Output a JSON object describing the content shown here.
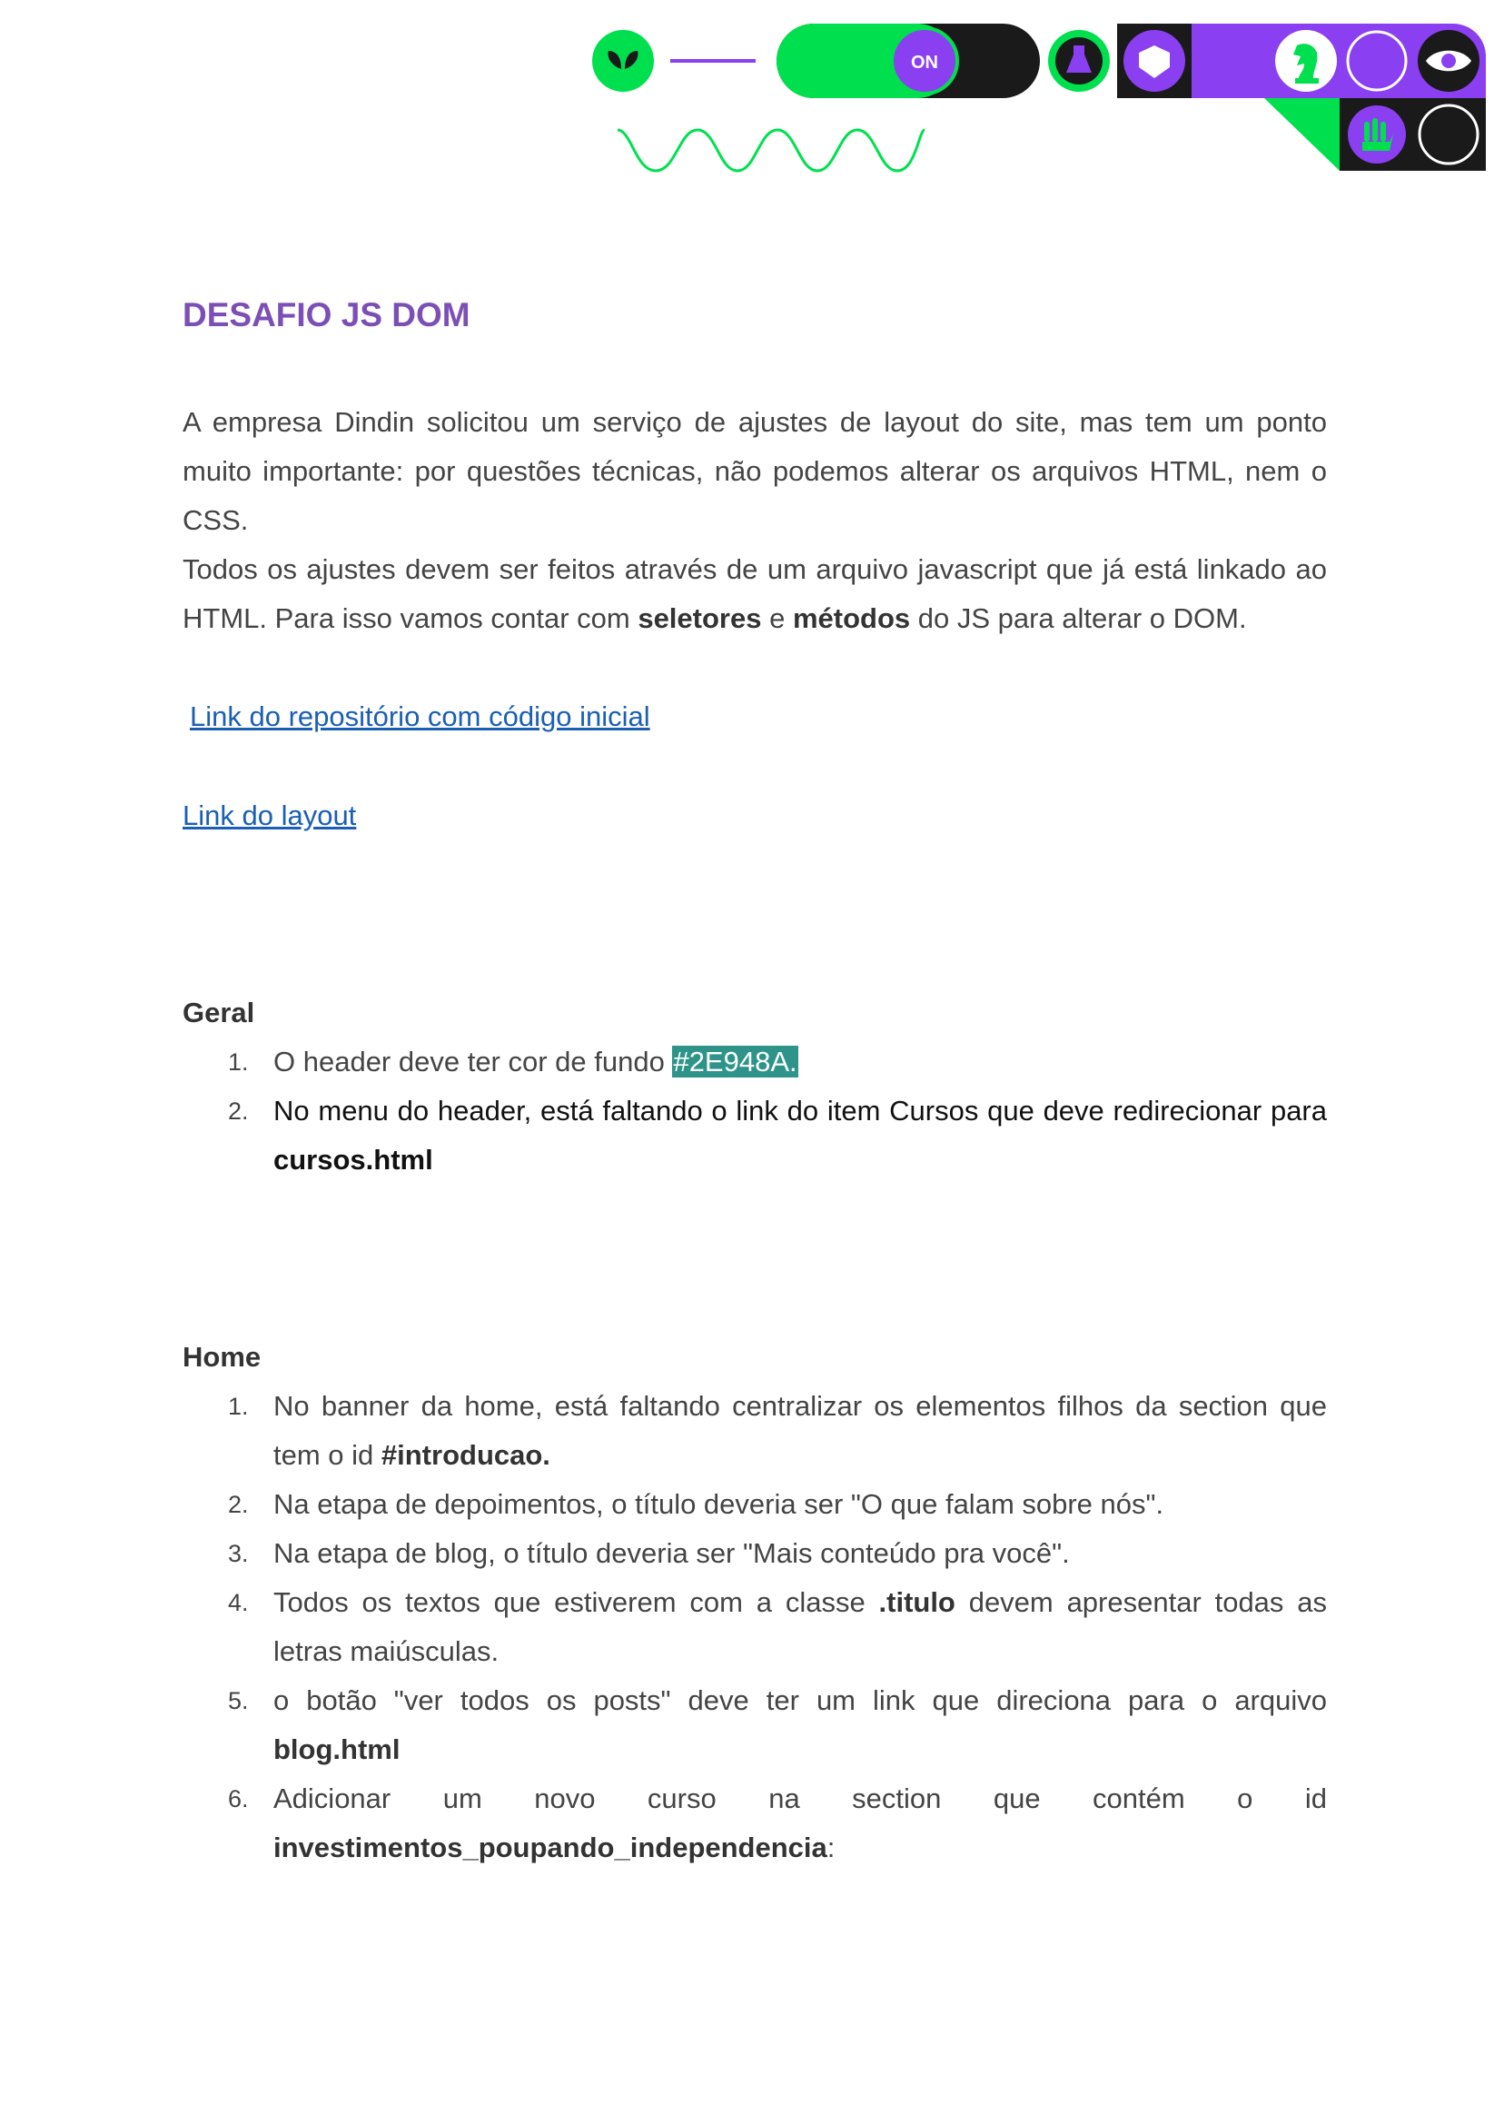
{
  "header_art": {
    "on_toggle_label": "ON",
    "colors": {
      "green": "#00e04f",
      "purple": "#8a3ff0",
      "black": "#1a1a1a"
    },
    "icons": [
      "leaf-icon",
      "toggle-switch-icon",
      "flask-icon",
      "heart-shield-icon",
      "chess-knight-icon",
      "eye-icon",
      "money-hand-icon",
      "wave-line-icon"
    ]
  },
  "document": {
    "title": "DESAFIO JS DOM",
    "intro_p1": "A empresa Dindin solicitou um serviço de ajustes de layout do site, mas tem um ponto muito importante: por questões técnicas, não podemos alterar os arquivos HTML, nem o CSS.",
    "intro_p2_a": "Todos os ajustes devem ser feitos através de um arquivo javascript que já está linkado ao HTML. Para isso vamos contar com ",
    "intro_p2_b": "seletores",
    "intro_p2_c": " e ",
    "intro_p2_d": "métodos",
    "intro_p2_e": " do JS para alterar o DOM.",
    "link_repo": "Link do repositório com código inicial",
    "link_layout": "Link do layout"
  },
  "geral": {
    "heading": "Geral",
    "items": [
      {
        "num": "1.",
        "text_a": "O header deve ter cor de fundo ",
        "highlight": "#2E948A."
      },
      {
        "num": "2.",
        "text_a": "No menu do header, está faltando o link do item Cursos que deve redirecionar para ",
        "bold": "cursos.html"
      }
    ]
  },
  "home": {
    "heading": "Home",
    "items": [
      {
        "num": "1.",
        "text_a": "No banner da home, está faltando centralizar os elementos filhos da section que tem o id ",
        "bold": "#introducao.",
        "text_b": ""
      },
      {
        "num": "2.",
        "text_a": "Na etapa de depoimentos, o título deveria ser \"O que falam sobre nós\".",
        "bold": "",
        "text_b": ""
      },
      {
        "num": "3.",
        "text_a": "Na etapa de blog, o título deveria ser \"Mais conteúdo pra você\".",
        "bold": "",
        "text_b": ""
      },
      {
        "num": "4.",
        "text_a": "Todos os textos que estiverem com a classe ",
        "bold": ".titulo",
        "text_b": " devem apresentar todas as letras maiúsculas."
      },
      {
        "num": "5.",
        "text_a": "o botão \"ver todos os posts\" deve ter um link que direciona para o arquivo ",
        "bold": "blog.html",
        "text_b": ""
      },
      {
        "num": "6.",
        "text_a": "Adicionar um novo curso na section que contém o id ",
        "bold": "investimentos_poupando_independencia",
        "text_b": ":"
      }
    ]
  }
}
